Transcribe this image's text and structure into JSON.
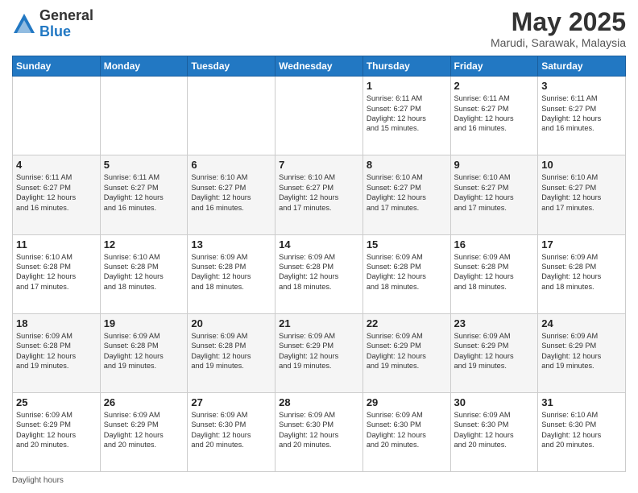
{
  "header": {
    "logo_line1": "General",
    "logo_line2": "Blue",
    "month_title": "May 2025",
    "location": "Marudi, Sarawak, Malaysia"
  },
  "weekdays": [
    "Sunday",
    "Monday",
    "Tuesday",
    "Wednesday",
    "Thursday",
    "Friday",
    "Saturday"
  ],
  "weeks": [
    [
      {
        "day": "",
        "info": ""
      },
      {
        "day": "",
        "info": ""
      },
      {
        "day": "",
        "info": ""
      },
      {
        "day": "",
        "info": ""
      },
      {
        "day": "1",
        "info": "Sunrise: 6:11 AM\nSunset: 6:27 PM\nDaylight: 12 hours\nand 15 minutes."
      },
      {
        "day": "2",
        "info": "Sunrise: 6:11 AM\nSunset: 6:27 PM\nDaylight: 12 hours\nand 16 minutes."
      },
      {
        "day": "3",
        "info": "Sunrise: 6:11 AM\nSunset: 6:27 PM\nDaylight: 12 hours\nand 16 minutes."
      }
    ],
    [
      {
        "day": "4",
        "info": "Sunrise: 6:11 AM\nSunset: 6:27 PM\nDaylight: 12 hours\nand 16 minutes."
      },
      {
        "day": "5",
        "info": "Sunrise: 6:11 AM\nSunset: 6:27 PM\nDaylight: 12 hours\nand 16 minutes."
      },
      {
        "day": "6",
        "info": "Sunrise: 6:10 AM\nSunset: 6:27 PM\nDaylight: 12 hours\nand 16 minutes."
      },
      {
        "day": "7",
        "info": "Sunrise: 6:10 AM\nSunset: 6:27 PM\nDaylight: 12 hours\nand 17 minutes."
      },
      {
        "day": "8",
        "info": "Sunrise: 6:10 AM\nSunset: 6:27 PM\nDaylight: 12 hours\nand 17 minutes."
      },
      {
        "day": "9",
        "info": "Sunrise: 6:10 AM\nSunset: 6:27 PM\nDaylight: 12 hours\nand 17 minutes."
      },
      {
        "day": "10",
        "info": "Sunrise: 6:10 AM\nSunset: 6:27 PM\nDaylight: 12 hours\nand 17 minutes."
      }
    ],
    [
      {
        "day": "11",
        "info": "Sunrise: 6:10 AM\nSunset: 6:28 PM\nDaylight: 12 hours\nand 17 minutes."
      },
      {
        "day": "12",
        "info": "Sunrise: 6:10 AM\nSunset: 6:28 PM\nDaylight: 12 hours\nand 18 minutes."
      },
      {
        "day": "13",
        "info": "Sunrise: 6:09 AM\nSunset: 6:28 PM\nDaylight: 12 hours\nand 18 minutes."
      },
      {
        "day": "14",
        "info": "Sunrise: 6:09 AM\nSunset: 6:28 PM\nDaylight: 12 hours\nand 18 minutes."
      },
      {
        "day": "15",
        "info": "Sunrise: 6:09 AM\nSunset: 6:28 PM\nDaylight: 12 hours\nand 18 minutes."
      },
      {
        "day": "16",
        "info": "Sunrise: 6:09 AM\nSunset: 6:28 PM\nDaylight: 12 hours\nand 18 minutes."
      },
      {
        "day": "17",
        "info": "Sunrise: 6:09 AM\nSunset: 6:28 PM\nDaylight: 12 hours\nand 18 minutes."
      }
    ],
    [
      {
        "day": "18",
        "info": "Sunrise: 6:09 AM\nSunset: 6:28 PM\nDaylight: 12 hours\nand 19 minutes."
      },
      {
        "day": "19",
        "info": "Sunrise: 6:09 AM\nSunset: 6:28 PM\nDaylight: 12 hours\nand 19 minutes."
      },
      {
        "day": "20",
        "info": "Sunrise: 6:09 AM\nSunset: 6:28 PM\nDaylight: 12 hours\nand 19 minutes."
      },
      {
        "day": "21",
        "info": "Sunrise: 6:09 AM\nSunset: 6:29 PM\nDaylight: 12 hours\nand 19 minutes."
      },
      {
        "day": "22",
        "info": "Sunrise: 6:09 AM\nSunset: 6:29 PM\nDaylight: 12 hours\nand 19 minutes."
      },
      {
        "day": "23",
        "info": "Sunrise: 6:09 AM\nSunset: 6:29 PM\nDaylight: 12 hours\nand 19 minutes."
      },
      {
        "day": "24",
        "info": "Sunrise: 6:09 AM\nSunset: 6:29 PM\nDaylight: 12 hours\nand 19 minutes."
      }
    ],
    [
      {
        "day": "25",
        "info": "Sunrise: 6:09 AM\nSunset: 6:29 PM\nDaylight: 12 hours\nand 20 minutes."
      },
      {
        "day": "26",
        "info": "Sunrise: 6:09 AM\nSunset: 6:29 PM\nDaylight: 12 hours\nand 20 minutes."
      },
      {
        "day": "27",
        "info": "Sunrise: 6:09 AM\nSunset: 6:30 PM\nDaylight: 12 hours\nand 20 minutes."
      },
      {
        "day": "28",
        "info": "Sunrise: 6:09 AM\nSunset: 6:30 PM\nDaylight: 12 hours\nand 20 minutes."
      },
      {
        "day": "29",
        "info": "Sunrise: 6:09 AM\nSunset: 6:30 PM\nDaylight: 12 hours\nand 20 minutes."
      },
      {
        "day": "30",
        "info": "Sunrise: 6:09 AM\nSunset: 6:30 PM\nDaylight: 12 hours\nand 20 minutes."
      },
      {
        "day": "31",
        "info": "Sunrise: 6:10 AM\nSunset: 6:30 PM\nDaylight: 12 hours\nand 20 minutes."
      }
    ]
  ],
  "footer": {
    "daylight_label": "Daylight hours"
  },
  "colors": {
    "header_bg": "#2278c3",
    "alt_row_bg": "#f5f5f5",
    "accent": "#2278c3"
  }
}
